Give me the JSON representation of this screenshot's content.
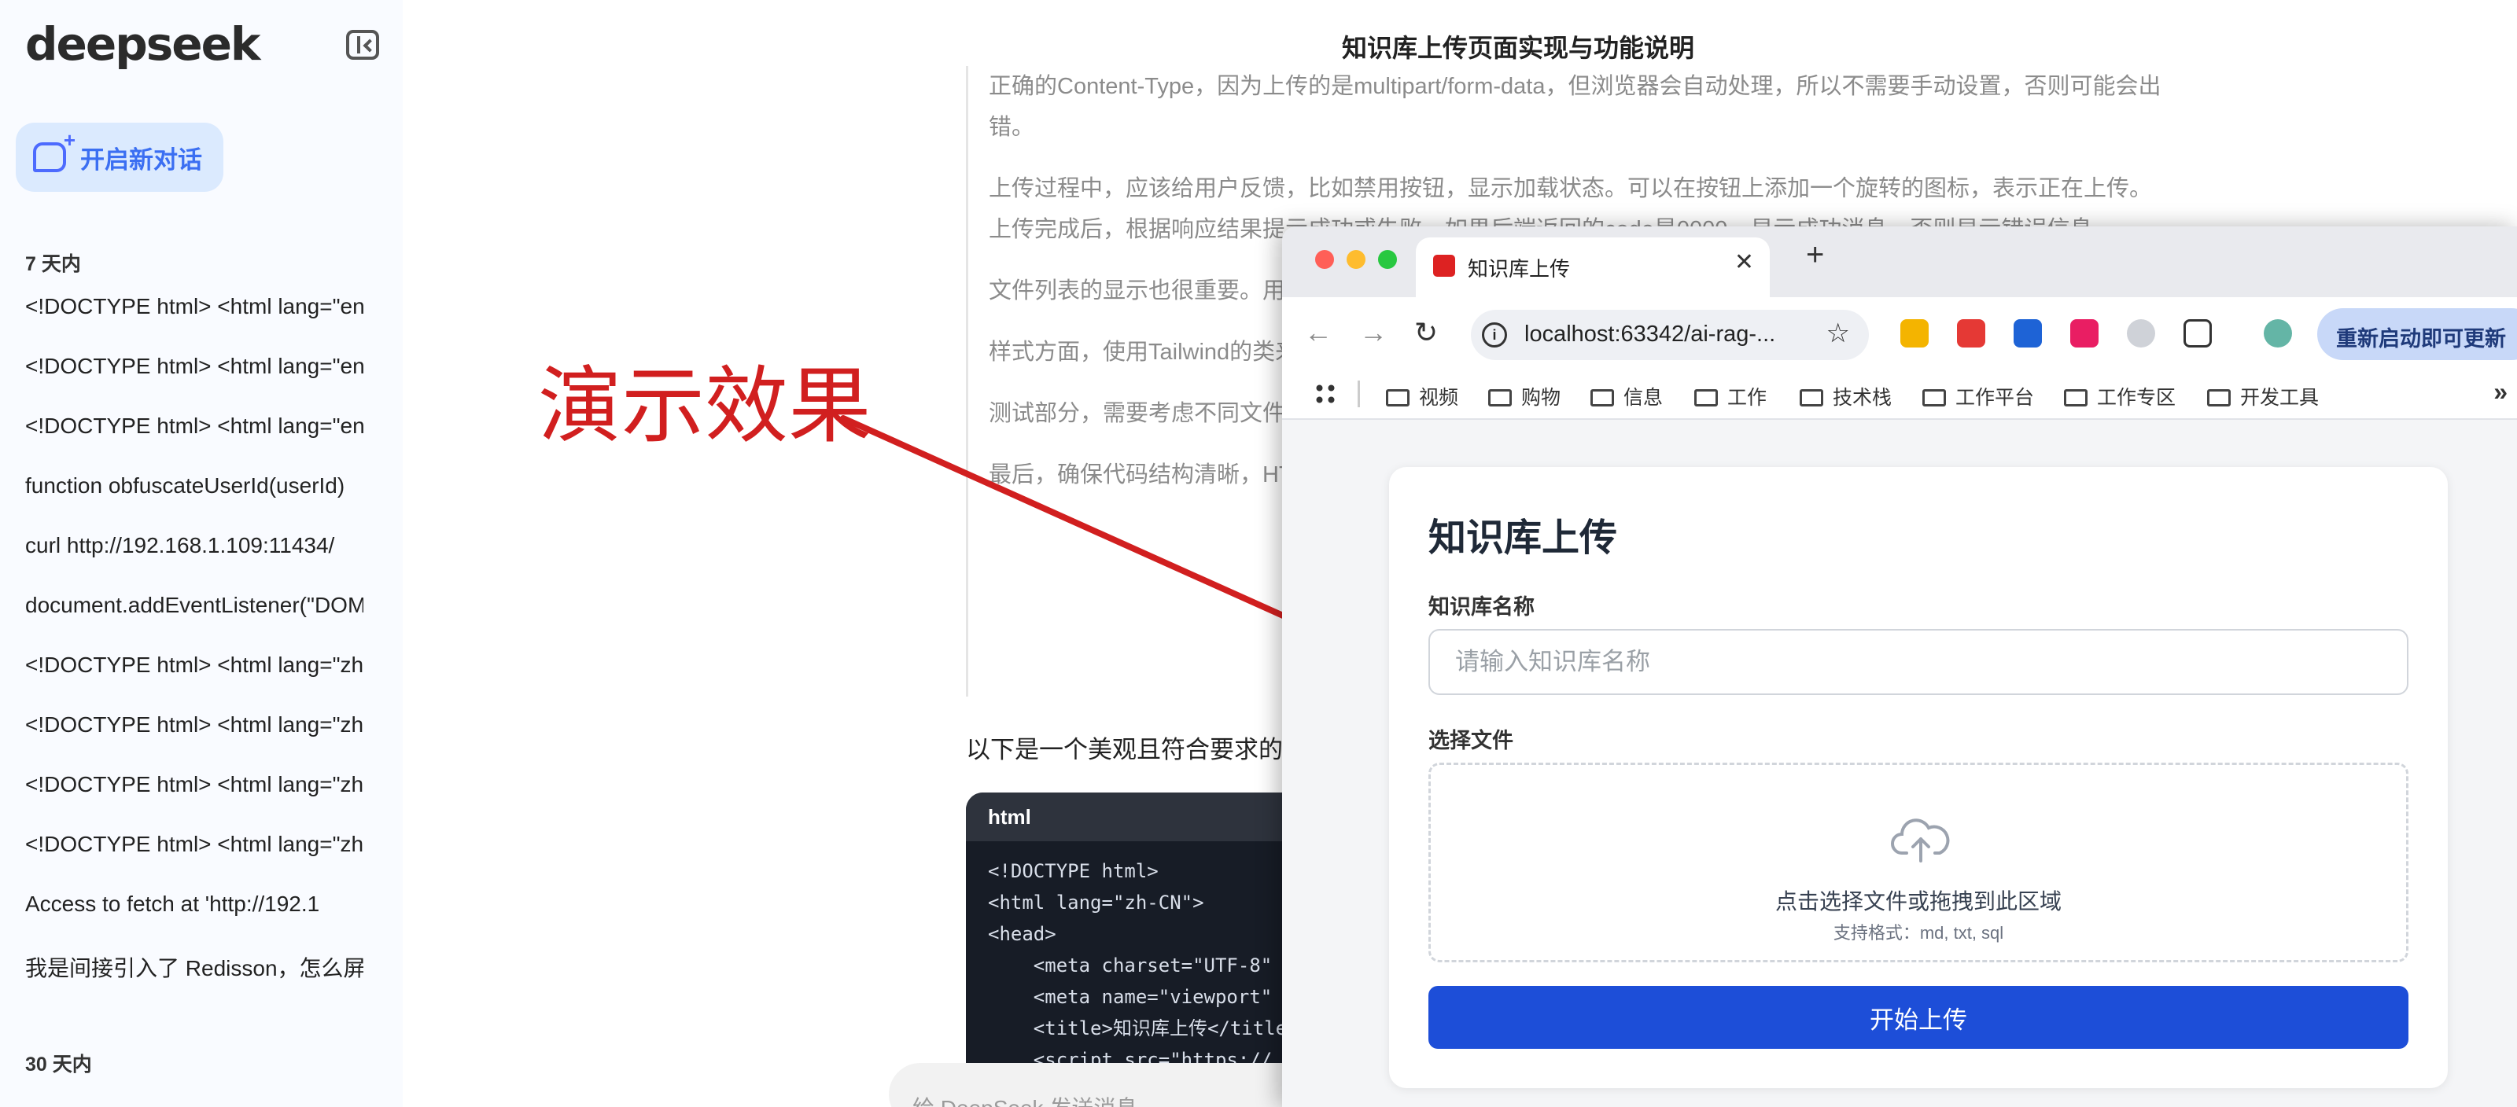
{
  "sidebar": {
    "brand": "deepseek",
    "new_chat_label": "开启新对话",
    "section_recent": "7 天内",
    "section_older": "30 天内",
    "history": [
      "<!DOCTYPE html> <html lang=\"en",
      "<!DOCTYPE html> <html lang=\"en",
      "<!DOCTYPE html> <html lang=\"en",
      "function obfuscateUserId(userId)",
      "curl http://192.168.1.109:11434/",
      "document.addEventListener(\"DOM",
      "<!DOCTYPE html> <html lang=\"zh",
      "<!DOCTYPE html> <html lang=\"zh",
      "<!DOCTYPE html> <html lang=\"zh",
      "<!DOCTYPE html> <html lang=\"zh",
      "Access to fetch at 'http://192.1",
      "我是间接引入了 Redisson，怎么屏"
    ]
  },
  "main": {
    "title": "知识库上传页面实现与功能说明",
    "thinking": [
      "正确的Content-Type，因为上传的是multipart/form-data，但浏览器会自动处理，所以不需要手动设置，否则可能会出错。",
      "上传过程中，应该给用户反馈，比如禁用按钮，显示加载状态。可以在按钮上添加一个旋转的图标，表示正在上传。上传完成后，根据响应结果提示成功或失败。如果后端返回的code是0000，显示成功消息，否则显示错误信息。",
      "文件列表的显示也很重要。用户选择文件后，显示文件名和大小，并在上传完成后清空。",
      "样式方面，使用Tailwind的类来美化，变化，文件区域有虚线边框，按钮要，除非明确提到。",
      "测试部分，需要考虑不同文件类型，还需要处理大文件上传的情况，",
      "最后，确保代码结构清晰，HTML引入，所有功能在浏览器中测试"
    ],
    "intro": "以下是一个美观且符合要求的",
    "code_lang": "html",
    "code_lines": [
      "<!DOCTYPE html>",
      "<html lang=\"zh-CN\">",
      "<head>",
      "    <meta charset=\"UTF-8\"",
      "    <meta name=\"viewport\"",
      "    <title>知识库上传</title>",
      "    <script src=\"https://"
    ],
    "composer_placeholder": "给 DeepSeek 发送消息"
  },
  "annotation": {
    "label": "演示效果",
    "color": "#d11f1f"
  },
  "browser": {
    "tab_title": "知识库上传",
    "url": "localhost:63342/ai-rag-...",
    "update_label": "重新启动即可更新",
    "bookmarks": [
      "视频",
      "购物",
      "信息",
      "工作",
      "技术栈",
      "工作平台",
      "工作专区",
      "开发工具"
    ],
    "icons": [
      "back-icon",
      "forward-icon",
      "reload-icon",
      "info-icon",
      "star-icon",
      "extensions-icon",
      "apps-icon",
      "folder-icon",
      "more-icon"
    ]
  },
  "upload_page": {
    "title": "知识库上传",
    "name_label": "知识库名称",
    "name_placeholder": "请输入知识库名称",
    "file_label": "选择文件",
    "drop_text": "点击选择文件或拖拽到此区域",
    "drop_hint": "支持格式：md, txt, sql",
    "submit_label": "开始上传",
    "accent": "#1d4ed8"
  }
}
